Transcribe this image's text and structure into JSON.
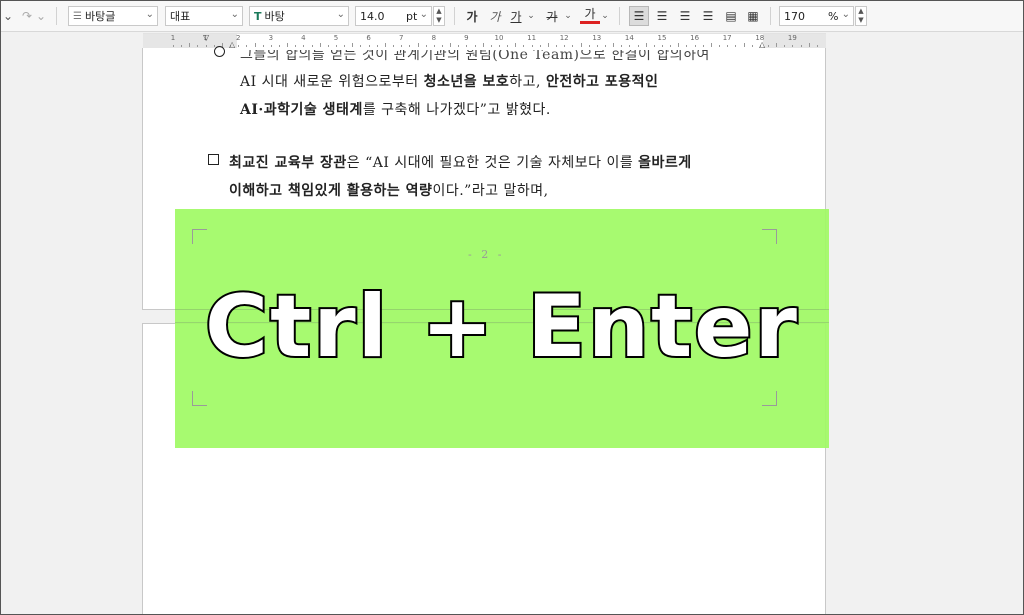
{
  "toolbar": {
    "style_select": "바탕글",
    "lang_select": "대표",
    "font_select": "바탕",
    "font_icon": "T",
    "size_value": "14.0",
    "size_unit": "pt",
    "bold_label": "가",
    "italic_label": "가",
    "underline_label": "가",
    "strike_label": "가",
    "color_label": "가",
    "zoom_value": "170",
    "zoom_unit": "%"
  },
  "ruler": {
    "numbers": [
      "1",
      "1",
      "2",
      "3",
      "4",
      "5",
      "6",
      "7",
      "8",
      "9",
      "10",
      "11",
      "12",
      "13",
      "14",
      "15",
      "16",
      "17",
      "18",
      "19"
    ]
  },
  "document": {
    "line1_partial": "그들의 합의를 얻는 것이 관계기관의 원팀(One Team)으로 한결이 합의하여",
    "line2_pre": "AI 시대 새로운 위험으로부터 ",
    "line2_b1": "청소년을 보호",
    "line2_mid": "하고, ",
    "line2_b2": "안전하고 포용적인",
    "line3_b": "AI·과학기술 생태계",
    "line3_post": "를 구축해 나가겠다”고 밝혔다.",
    "line4_b": "최교진 교육부 장관",
    "line4_post": "은 “AI 시대에 필요한 것은 기술 자체보다 이를 ",
    "line4_b2": "올바르게",
    "line5_b": "이해하고 책임있게 활용하는 역량",
    "line5_post": "이다.”라고 말하며,",
    "page_number": "- 2 -"
  },
  "overlay": {
    "shortcut": "Ctrl + Enter",
    "color": "#a0fa64"
  }
}
